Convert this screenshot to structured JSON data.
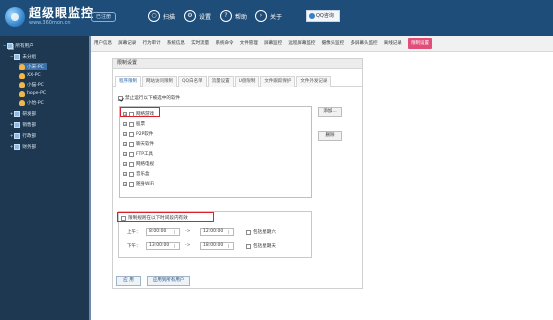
{
  "header": {
    "logo_title": "超级眼监控",
    "logo_url": "www.360mon.cn",
    "badge": "已注册",
    "nav": [
      {
        "label": "扫描",
        "icon": "scan-icon"
      },
      {
        "label": "设置",
        "icon": "gear-icon"
      },
      {
        "label": "帮助",
        "icon": "help-icon"
      },
      {
        "label": "关于",
        "icon": "about-icon"
      }
    ],
    "qq_button": "QQ咨询"
  },
  "sidebar": {
    "root": "所有用户",
    "group_unassigned": "未分组",
    "users": [
      "小宋-PC",
      "XX-PC",
      "小猫-PC",
      "hope-PC",
      "小怡-PC"
    ],
    "selected_user": "小宋-PC",
    "groups": [
      "研发部",
      "销售部",
      "行政部",
      "财务部"
    ]
  },
  "topnav": {
    "tabs": [
      "用户信息",
      "屏幕记录",
      "行为审计",
      "系统信息",
      "实时流量",
      "系统命令",
      "文件管理",
      "屏幕监控",
      "远程屏幕监控",
      "摄像头监控",
      "多屏幕头监控",
      "离线记录",
      "限制设置"
    ],
    "active": "限制设置"
  },
  "panel": {
    "title": "限制设置",
    "subtabs": [
      "程序限制",
      "网站访问限制",
      "QQ白名单",
      "流量设置",
      "U盘限制",
      "文件跟踪保护",
      "文件外发记录"
    ],
    "active_subtab": "程序限制",
    "forbid_checkbox": "禁止运行以下被选中的软件",
    "programs": [
      "网络游戏",
      "股票",
      "P2P软件",
      "聊天软件",
      "FTP工具",
      "网络电视",
      "音乐盒",
      "随身WiFi"
    ],
    "add_button": "添加...",
    "delete_button": "删除",
    "time_checkbox": "限制规则在以下时间段内有效",
    "morning_label": "上午：",
    "afternoon_label": "下午：",
    "morning_start": "8:00:00",
    "morning_end": "12:00:00",
    "afternoon_start": "13:00:00",
    "afternoon_end": "18:00:00",
    "arrow": "->",
    "saturday": "包括星期六",
    "sunday": "包括星期天",
    "apply_button": "应 用",
    "apply_all_button": "应用到所有用户"
  }
}
